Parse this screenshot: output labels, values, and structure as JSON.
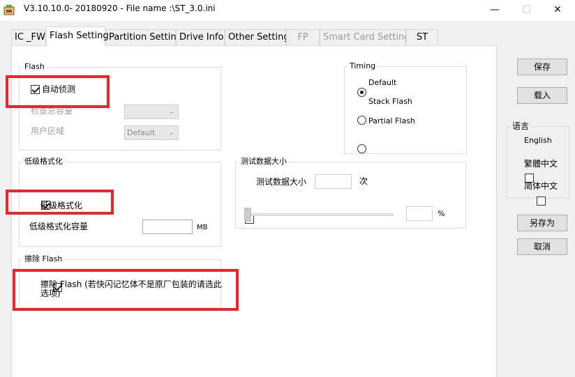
{
  "window": {
    "title": "V3.10.10.0- 20180920 - File name :\\ST_3.0.ini",
    "minimize": "—",
    "maximize": "☐",
    "close": "✕"
  },
  "tabs": [
    {
      "label": "IC _FW"
    },
    {
      "label": "Flash Setting"
    },
    {
      "label": "Partition Setting"
    },
    {
      "label": "Drive Info"
    },
    {
      "label": "Other Setting"
    },
    {
      "label": "FP"
    },
    {
      "label": "Smart Card Setting"
    },
    {
      "label": "ST"
    }
  ],
  "flash": {
    "legend": "Flash",
    "auto_detect_label": "自动侦测",
    "auto_detect_checked": true,
    "check_capacity_label": "检查总容量",
    "check_capacity_value": "",
    "user_area_label": "用户区域",
    "user_area_value": "Default"
  },
  "low_format": {
    "legend": "低级格式化",
    "checkbox_label": "低级格式化",
    "checked": true,
    "capacity_label": "低级格式化容量",
    "capacity_value": "",
    "capacity_unit": "MB"
  },
  "erase": {
    "legend": "擦除 Flash",
    "checkbox_label_line1": "擦除 Flash (若快闪记忆体不是原厂包装的请选此",
    "checkbox_label_line2": "选项)",
    "checked": true
  },
  "timing": {
    "legend": "Timing",
    "options": [
      {
        "label": "Default",
        "selected": true
      },
      {
        "label": "Stack Flash",
        "selected": false
      },
      {
        "label": "Partial Flash",
        "selected": false
      }
    ]
  },
  "test_data": {
    "legend": "测试数据大小",
    "checkbox_label": "测试数据大小",
    "checked": false,
    "count_value": "",
    "count_unit": "次",
    "percent_value": "",
    "percent_unit": "%",
    "slider_position": 0
  },
  "buttons": {
    "save": "保存",
    "load": "载入",
    "save_as": "另存为",
    "cancel": "取消"
  },
  "language": {
    "legend": "语言",
    "options": [
      {
        "label": "English",
        "checked": false
      },
      {
        "label": "繁體中文",
        "checked": false
      },
      {
        "label": "简体中文",
        "checked": true
      }
    ]
  },
  "colors": {
    "highlight_red": "#e8262c",
    "panel_bg": "#ffffff",
    "window_bg": "#f0f0f0"
  }
}
